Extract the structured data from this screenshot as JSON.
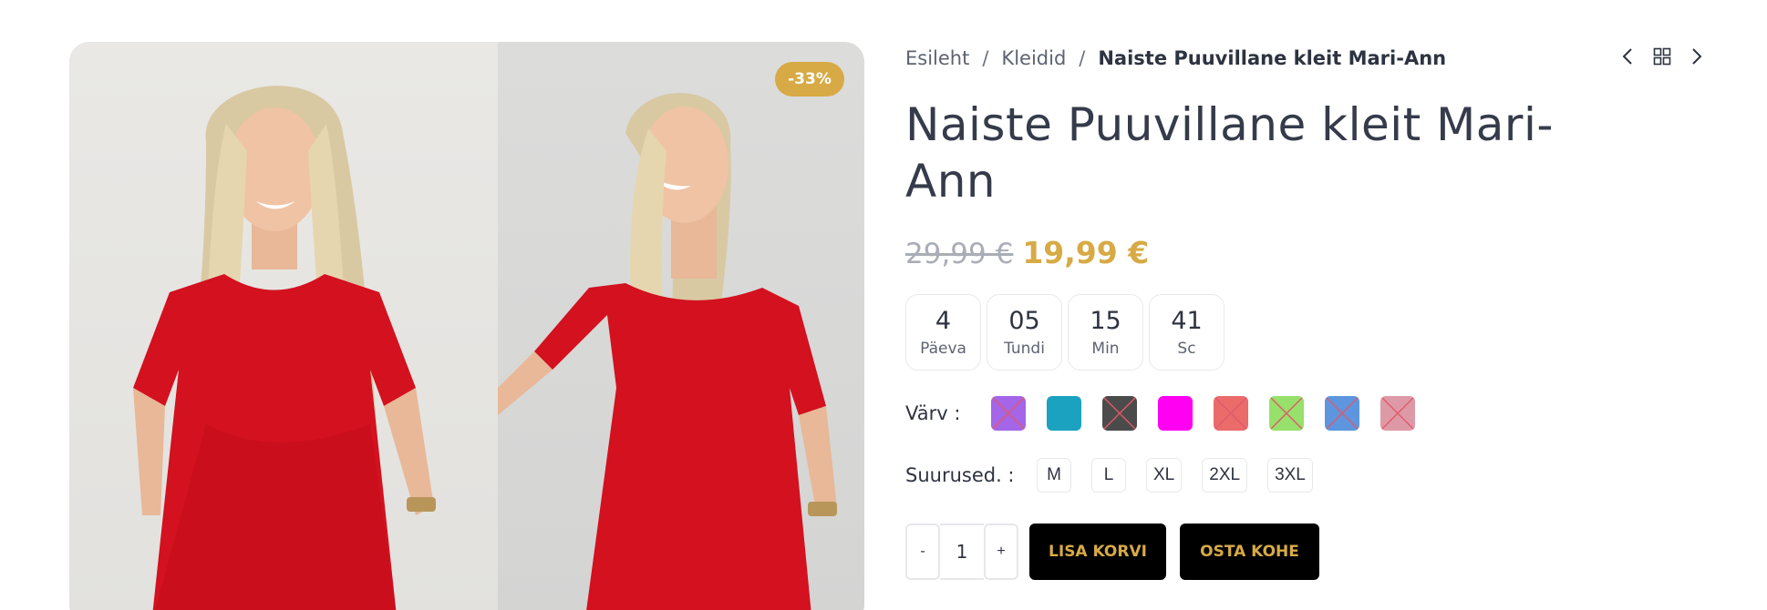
{
  "gallery": {
    "discount_badge": "-33%"
  },
  "breadcrumb": {
    "home": "Esileht",
    "separator": "/",
    "category": "Kleidid",
    "current": "Naiste Puuvillane kleit Mari-Ann"
  },
  "product": {
    "title": "Naiste Puuvillane kleit Mari-Ann",
    "old_price": "29,99 €",
    "new_price": "19,99 €"
  },
  "countdown": [
    {
      "value": "4",
      "label": "Päeva"
    },
    {
      "value": "05",
      "label": "Tundi"
    },
    {
      "value": "15",
      "label": "Min"
    },
    {
      "value": "41",
      "label": "Sc"
    }
  ],
  "colors": {
    "label": "Värv :",
    "swatches": [
      {
        "color": "#a565e8",
        "unavailable": true
      },
      {
        "color": "#1aa2c0",
        "unavailable": false
      },
      {
        "color": "#4b4b4b",
        "unavailable": true
      },
      {
        "color": "#ff00f2",
        "unavailable": false
      },
      {
        "color": "#eb6b6b",
        "unavailable": true
      },
      {
        "color": "#97e06b",
        "unavailable": true
      },
      {
        "color": "#5d96de",
        "unavailable": true
      },
      {
        "color": "#dd9aa6",
        "unavailable": true
      }
    ]
  },
  "sizes": {
    "label": "Suurused. :",
    "options": [
      "M",
      "L",
      "XL",
      "2XL",
      "3XL"
    ]
  },
  "quantity": {
    "minus": "-",
    "value": "1",
    "plus": "+"
  },
  "buttons": {
    "add_to_cart": "LISA KORVI",
    "buy_now": "OSTA KOHE"
  },
  "icons": {
    "prev": "chevron-left-icon",
    "grid": "grid-icon",
    "next": "chevron-right-icon"
  },
  "theme": {
    "accent": "#d7aa45",
    "text": "#2d3340",
    "button_bg": "#000000"
  }
}
